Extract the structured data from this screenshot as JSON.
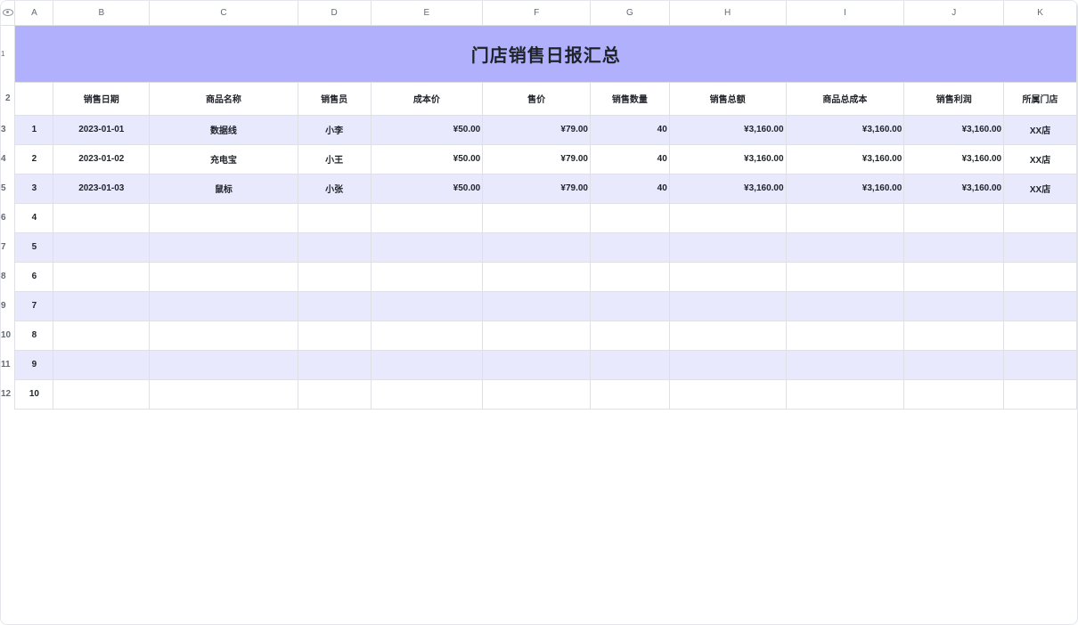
{
  "columns": [
    "A",
    "B",
    "C",
    "D",
    "E",
    "F",
    "G",
    "H",
    "I",
    "J",
    "K"
  ],
  "row_numbers": [
    "1",
    "2",
    "3",
    "4",
    "5",
    "6",
    "7",
    "8",
    "9",
    "10",
    "11",
    "12"
  ],
  "title": "门店销售日报汇总",
  "headers": [
    "销售日期",
    "商品名称",
    "销售员",
    "成本价",
    "售价",
    "销售数量",
    "销售总额",
    "商品总成本",
    "销售利润",
    "所属门店"
  ],
  "rows": [
    {
      "no": "1",
      "date": "2023-01-01",
      "product": "数据线",
      "seller": "小李",
      "cost": "¥50.00",
      "price": "¥79.00",
      "qty": "40",
      "total": "¥3,160.00",
      "total_cost": "¥3,160.00",
      "profit": "¥3,160.00",
      "store": "XX店"
    },
    {
      "no": "2",
      "date": "2023-01-02",
      "product": "充电宝",
      "seller": "小王",
      "cost": "¥50.00",
      "price": "¥79.00",
      "qty": "40",
      "total": "¥3,160.00",
      "total_cost": "¥3,160.00",
      "profit": "¥3,160.00",
      "store": "XX店"
    },
    {
      "no": "3",
      "date": "2023-01-03",
      "product": "鼠标",
      "seller": "小张",
      "cost": "¥50.00",
      "price": "¥79.00",
      "qty": "40",
      "total": "¥3,160.00",
      "total_cost": "¥3,160.00",
      "profit": "¥3,160.00",
      "store": "XX店"
    },
    {
      "no": "4"
    },
    {
      "no": "5"
    },
    {
      "no": "6"
    },
    {
      "no": "7"
    },
    {
      "no": "8"
    },
    {
      "no": "9"
    },
    {
      "no": "10"
    }
  ],
  "colors": {
    "title_bg": "#b0b0fc",
    "band": "#e8e9fd",
    "grid": "#dee0e3"
  },
  "icons": {
    "corner": "eye-icon"
  }
}
